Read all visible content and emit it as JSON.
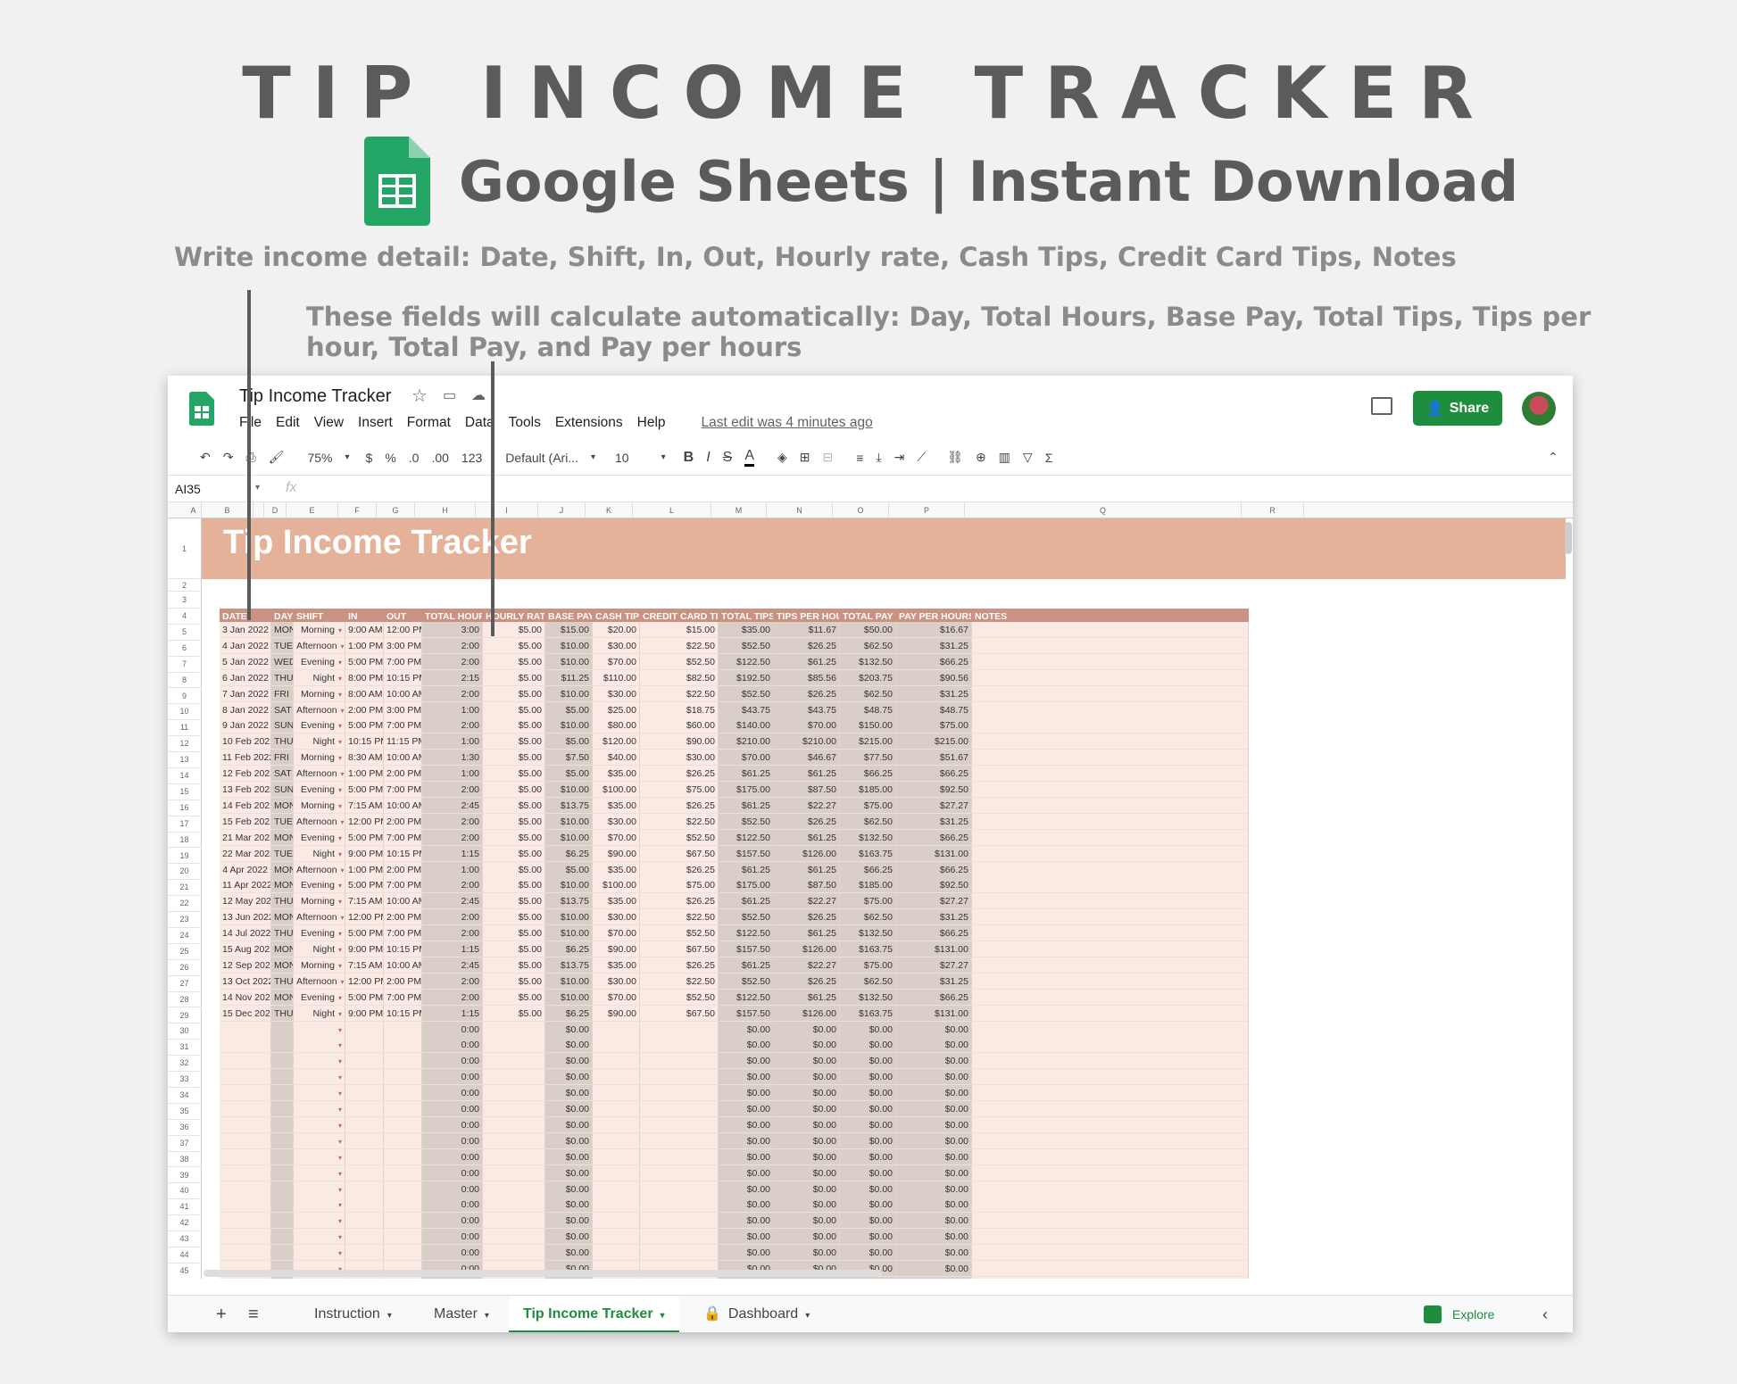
{
  "hero": {
    "title": "TIP INCOME TRACKER",
    "subtitle": "Google Sheets | Instant Download"
  },
  "notes": {
    "manual": "Write income detail: Date, Shift, In, Out, Hourly rate, Cash Tips, Credit Card Tips, Notes",
    "auto": "These fields will calculate automatically: Day, Total Hours, Base Pay, Total Tips, Tips per hour, Total Pay, and Pay per hours"
  },
  "window": {
    "doc_title": "Tip Income Tracker",
    "menu": [
      "File",
      "Edit",
      "View",
      "Insert",
      "Format",
      "Data",
      "Tools",
      "Extensions",
      "Help"
    ],
    "last_edit": "Last edit was 4 minutes ago",
    "share_label": "Share",
    "toolbar": {
      "zoom": "75%",
      "currency": "$",
      "percent": "%",
      "dec_minus": ".0",
      "dec_plus": ".00",
      "format": "123",
      "font": "Default (Ari...",
      "font_size": "10",
      "bold": "B",
      "italic": "I",
      "strike": "S",
      "text_color": "A"
    },
    "namebox": "AI35",
    "fx": "fx"
  },
  "grid": {
    "col_letters": [
      "A",
      "B",
      "",
      "D",
      "E",
      "F",
      "G",
      "H",
      "I",
      "J",
      "K",
      "L",
      "M",
      "N",
      "O",
      "P",
      "Q",
      "R"
    ],
    "banner_title": "Tip Income Tracker",
    "headers": [
      "DATE",
      "DAY",
      "SHIFT",
      "IN",
      "OUT",
      "TOTAL HOURS",
      "HOURLY RATE",
      "BASE PAY",
      "CASH TIPS",
      "CREDIT CARD TIPS",
      "TOTAL TIPS",
      "TIPS PER HOUR",
      "TOTAL PAY",
      "PAY PER HOURS",
      "NOTES"
    ],
    "rows": [
      [
        "3 Jan 2022",
        "MON",
        "Morning",
        "9:00 AM",
        "12:00 PM",
        "3:00",
        "$5.00",
        "$15.00",
        "$20.00",
        "$15.00",
        "$35.00",
        "$11.67",
        "$50.00",
        "$16.67"
      ],
      [
        "4 Jan 2022",
        "TUE",
        "Afternoon",
        "1:00 PM",
        "3:00 PM",
        "2:00",
        "$5.00",
        "$10.00",
        "$30.00",
        "$22.50",
        "$52.50",
        "$26.25",
        "$62.50",
        "$31.25"
      ],
      [
        "5 Jan 2022",
        "WED",
        "Evening",
        "5:00 PM",
        "7:00 PM",
        "2:00",
        "$5.00",
        "$10.00",
        "$70.00",
        "$52.50",
        "$122.50",
        "$61.25",
        "$132.50",
        "$66.25"
      ],
      [
        "6 Jan 2022",
        "THU",
        "Night",
        "8:00 PM",
        "10:15 PM",
        "2:15",
        "$5.00",
        "$11.25",
        "$110.00",
        "$82.50",
        "$192.50",
        "$85.56",
        "$203.75",
        "$90.56"
      ],
      [
        "7 Jan 2022",
        "FRI",
        "Morning",
        "8:00 AM",
        "10:00 AM",
        "2:00",
        "$5.00",
        "$10.00",
        "$30.00",
        "$22.50",
        "$52.50",
        "$26.25",
        "$62.50",
        "$31.25"
      ],
      [
        "8 Jan 2022",
        "SAT",
        "Afternoon",
        "2:00 PM",
        "3:00 PM",
        "1:00",
        "$5.00",
        "$5.00",
        "$25.00",
        "$18.75",
        "$43.75",
        "$43.75",
        "$48.75",
        "$48.75"
      ],
      [
        "9 Jan 2022",
        "SUN",
        "Evening",
        "5:00 PM",
        "7:00 PM",
        "2:00",
        "$5.00",
        "$10.00",
        "$80.00",
        "$60.00",
        "$140.00",
        "$70.00",
        "$150.00",
        "$75.00"
      ],
      [
        "10 Feb 2022",
        "THU",
        "Night",
        "10:15 PM",
        "11:15 PM",
        "1:00",
        "$5.00",
        "$5.00",
        "$120.00",
        "$90.00",
        "$210.00",
        "$210.00",
        "$215.00",
        "$215.00"
      ],
      [
        "11 Feb 2022",
        "FRI",
        "Morning",
        "8:30 AM",
        "10:00 AM",
        "1:30",
        "$5.00",
        "$7.50",
        "$40.00",
        "$30.00",
        "$70.00",
        "$46.67",
        "$77.50",
        "$51.67"
      ],
      [
        "12 Feb 2022",
        "SAT",
        "Afternoon",
        "1:00 PM",
        "2:00 PM",
        "1:00",
        "$5.00",
        "$5.00",
        "$35.00",
        "$26.25",
        "$61.25",
        "$61.25",
        "$66.25",
        "$66.25"
      ],
      [
        "13 Feb 2022",
        "SUN",
        "Evening",
        "5:00 PM",
        "7:00 PM",
        "2:00",
        "$5.00",
        "$10.00",
        "$100.00",
        "$75.00",
        "$175.00",
        "$87.50",
        "$185.00",
        "$92.50"
      ],
      [
        "14 Feb 2022",
        "MON",
        "Morning",
        "7:15 AM",
        "10:00 AM",
        "2:45",
        "$5.00",
        "$13.75",
        "$35.00",
        "$26.25",
        "$61.25",
        "$22.27",
        "$75.00",
        "$27.27"
      ],
      [
        "15 Feb 2022",
        "TUE",
        "Afternoon",
        "12:00 PM",
        "2:00 PM",
        "2:00",
        "$5.00",
        "$10.00",
        "$30.00",
        "$22.50",
        "$52.50",
        "$26.25",
        "$62.50",
        "$31.25"
      ],
      [
        "21 Mar 2022",
        "MON",
        "Evening",
        "5:00 PM",
        "7:00 PM",
        "2:00",
        "$5.00",
        "$10.00",
        "$70.00",
        "$52.50",
        "$122.50",
        "$61.25",
        "$132.50",
        "$66.25"
      ],
      [
        "22 Mar 2022",
        "TUE",
        "Night",
        "9:00 PM",
        "10:15 PM",
        "1:15",
        "$5.00",
        "$6.25",
        "$90.00",
        "$67.50",
        "$157.50",
        "$126.00",
        "$163.75",
        "$131.00"
      ],
      [
        "4 Apr 2022",
        "MON",
        "Afternoon",
        "1:00 PM",
        "2:00 PM",
        "1:00",
        "$5.00",
        "$5.00",
        "$35.00",
        "$26.25",
        "$61.25",
        "$61.25",
        "$66.25",
        "$66.25"
      ],
      [
        "11 Apr 2022",
        "MON",
        "Evening",
        "5:00 PM",
        "7:00 PM",
        "2:00",
        "$5.00",
        "$10.00",
        "$100.00",
        "$75.00",
        "$175.00",
        "$87.50",
        "$185.00",
        "$92.50"
      ],
      [
        "12 May 2022",
        "THU",
        "Morning",
        "7:15 AM",
        "10:00 AM",
        "2:45",
        "$5.00",
        "$13.75",
        "$35.00",
        "$26.25",
        "$61.25",
        "$22.27",
        "$75.00",
        "$27.27"
      ],
      [
        "13 Jun 2022",
        "MON",
        "Afternoon",
        "12:00 PM",
        "2:00 PM",
        "2:00",
        "$5.00",
        "$10.00",
        "$30.00",
        "$22.50",
        "$52.50",
        "$26.25",
        "$62.50",
        "$31.25"
      ],
      [
        "14 Jul 2022",
        "THU",
        "Evening",
        "5:00 PM",
        "7:00 PM",
        "2:00",
        "$5.00",
        "$10.00",
        "$70.00",
        "$52.50",
        "$122.50",
        "$61.25",
        "$132.50",
        "$66.25"
      ],
      [
        "15 Aug 2022",
        "MON",
        "Night",
        "9:00 PM",
        "10:15 PM",
        "1:15",
        "$5.00",
        "$6.25",
        "$90.00",
        "$67.50",
        "$157.50",
        "$126.00",
        "$163.75",
        "$131.00"
      ],
      [
        "12 Sep 2022",
        "MON",
        "Morning",
        "7:15 AM",
        "10:00 AM",
        "2:45",
        "$5.00",
        "$13.75",
        "$35.00",
        "$26.25",
        "$61.25",
        "$22.27",
        "$75.00",
        "$27.27"
      ],
      [
        "13 Oct 2022",
        "THU",
        "Afternoon",
        "12:00 PM",
        "2:00 PM",
        "2:00",
        "$5.00",
        "$10.00",
        "$30.00",
        "$22.50",
        "$52.50",
        "$26.25",
        "$62.50",
        "$31.25"
      ],
      [
        "14 Nov 2022",
        "MON",
        "Evening",
        "5:00 PM",
        "7:00 PM",
        "2:00",
        "$5.00",
        "$10.00",
        "$70.00",
        "$52.50",
        "$122.50",
        "$61.25",
        "$132.50",
        "$66.25"
      ],
      [
        "15 Dec 2022",
        "THU",
        "Night",
        "9:00 PM",
        "10:15 PM",
        "1:15",
        "$5.00",
        "$6.25",
        "$90.00",
        "$67.50",
        "$157.50",
        "$126.00",
        "$163.75",
        "$131.00"
      ]
    ],
    "empty_row": [
      "",
      "",
      "",
      "",
      "",
      "0:00",
      "",
      "$0.00",
      "",
      "",
      "$0.00",
      "$0.00",
      "$0.00",
      "$0.00"
    ]
  },
  "tabs": {
    "add": "+",
    "list": "≡",
    "items": [
      "Instruction",
      "Master",
      "Tip Income Tracker",
      "Dashboard"
    ],
    "explore": "Explore"
  },
  "colors": {
    "banner": "#e6b199",
    "header": "#c99282",
    "row": "#fbe9e3",
    "calc": "#d9cfc8",
    "share": "#1e8e3e"
  }
}
